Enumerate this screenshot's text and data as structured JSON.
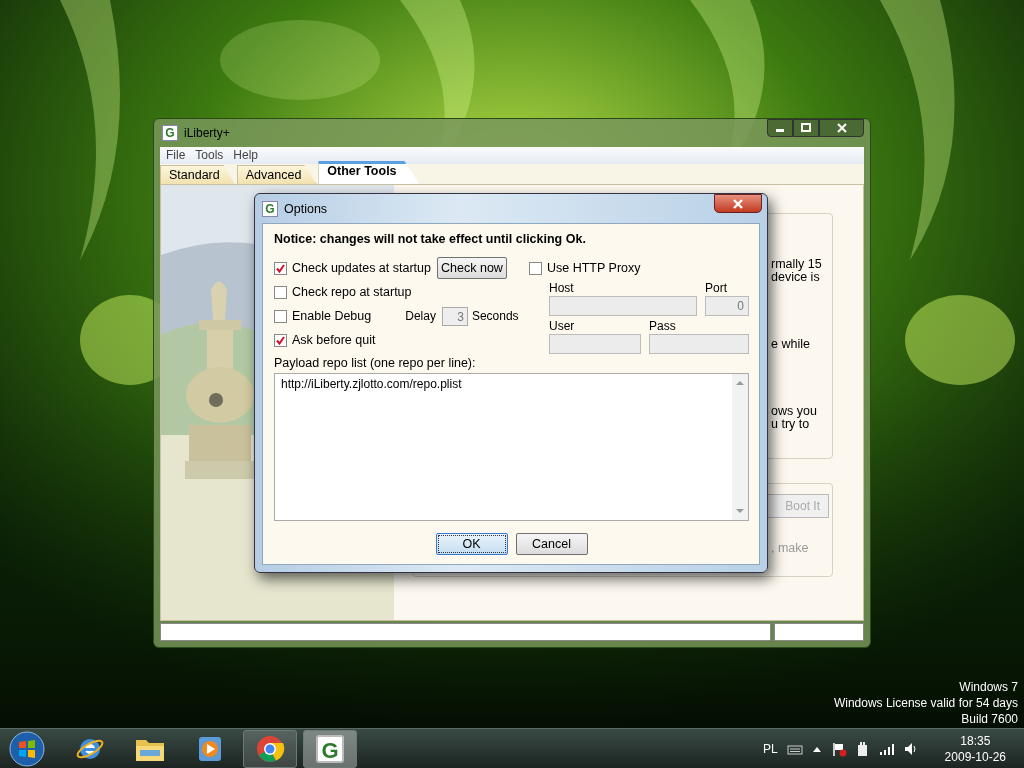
{
  "main_window": {
    "icon_letter": "G",
    "title": "iLiberty+",
    "menu": [
      "File",
      "Tools",
      "Help"
    ],
    "tabs": [
      {
        "label": "Standard",
        "selected": false
      },
      {
        "label": "Advanced",
        "selected": false
      },
      {
        "label": "Other Tools",
        "selected": true
      }
    ],
    "picture": {
      "kind": "picture"
    },
    "group_1_fragments": [
      "rmally 15",
      "device is",
      "e while",
      "ows you",
      "u try to"
    ],
    "group_2": {
      "button": {
        "label": "Boot It",
        "disabled": true
      },
      "fragment": ", make"
    }
  },
  "dialog": {
    "icon_letter": "G",
    "title": "Options",
    "notice": "Notice: changes will not take effect until clicking Ok.",
    "options": [
      {
        "label": "Check updates at startup",
        "checked": true
      },
      {
        "label": "Check repo at startup",
        "checked": false
      },
      {
        "label": "Enable Debug",
        "checked": false
      },
      {
        "label": "Ask before quit",
        "checked": true
      }
    ],
    "check_now_button": "Check now",
    "delay": {
      "label": "Delay",
      "value": "3",
      "unit": "Seconds"
    },
    "proxy": {
      "label": "Use HTTP Proxy",
      "checked": false,
      "fields": [
        {
          "label": "Host",
          "disabled": true
        },
        {
          "label": "Port",
          "value": "0",
          "disabled": true
        },
        {
          "label": "User",
          "disabled": true
        },
        {
          "label": "Pass",
          "disabled": true
        }
      ]
    },
    "payload_label": "Payload repo list (one repo per line):",
    "payload_value": "http://iLiberty.zjlotto.com/repo.plist",
    "buttons": [
      {
        "label": "OK",
        "default": true
      },
      {
        "label": "Cancel",
        "default": false
      }
    ]
  },
  "desktop_notice": [
    "Windows 7",
    "Windows License valid for 54 days",
    "Build 7600"
  ],
  "taskbar": {
    "apps": [
      {
        "kind": "ie",
        "running": false,
        "selected": false
      },
      {
        "kind": "explorer",
        "running": false,
        "selected": false
      },
      {
        "kind": "media",
        "running": false,
        "selected": false
      },
      {
        "kind": "chrome",
        "running": true,
        "selected": false
      },
      {
        "kind": "letter",
        "letter": "G",
        "running": true,
        "selected": true
      }
    ],
    "language": "PL",
    "time": "18:35",
    "date": "2009-10-26"
  }
}
